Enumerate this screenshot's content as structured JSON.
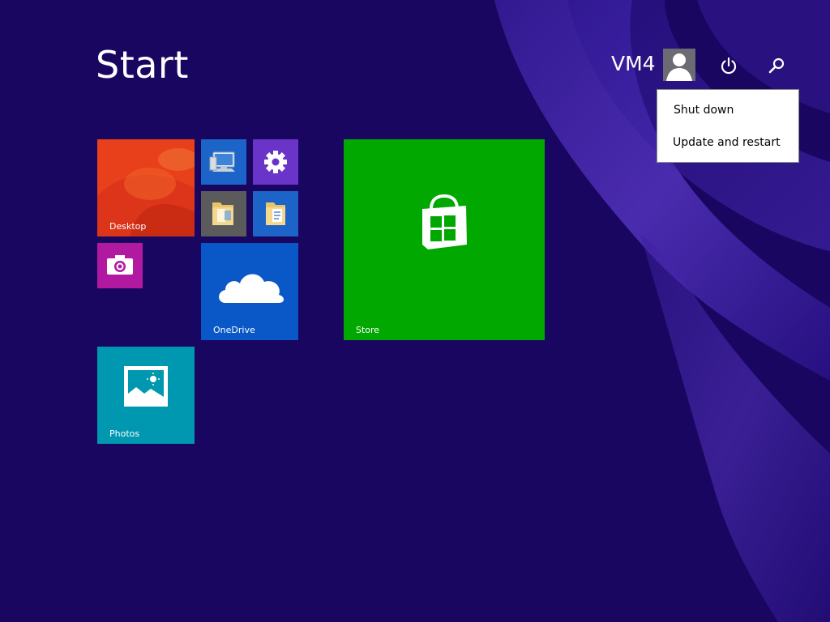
{
  "start_screen": {
    "title": "Start"
  },
  "user": {
    "name": "VM4"
  },
  "top_icons": {
    "power": "power-icon",
    "search": "search-icon",
    "avatar": "user-avatar-icon"
  },
  "power_menu": {
    "items": [
      {
        "label": "Shut down"
      },
      {
        "label": "Update and restart"
      }
    ]
  },
  "tiles": [
    {
      "label": "Desktop",
      "color": "#e8401a",
      "icon": "desktop-wallpaper"
    },
    {
      "label": "",
      "color": "#1d64c8",
      "icon": "computer-icon"
    },
    {
      "label": "",
      "color": "#6b34c9",
      "icon": "gear-icon"
    },
    {
      "label": "",
      "color": "#5b5b5b",
      "icon": "folder-icon"
    },
    {
      "label": "",
      "color": "#1d64c8",
      "icon": "documents-folder-icon"
    },
    {
      "label": "",
      "color": "#b11aa0",
      "icon": "camera-icon"
    },
    {
      "label": "OneDrive",
      "color": "#0a58c8",
      "icon": "cloud-icon"
    },
    {
      "label": "Store",
      "color": "#00a800",
      "icon": "shopping-bag-icon"
    },
    {
      "label": "Photos",
      "color": "#0097b0",
      "icon": "photo-icon"
    }
  ],
  "colors": {
    "background": "#190660",
    "accent_swirl": "#4a2bb0"
  }
}
